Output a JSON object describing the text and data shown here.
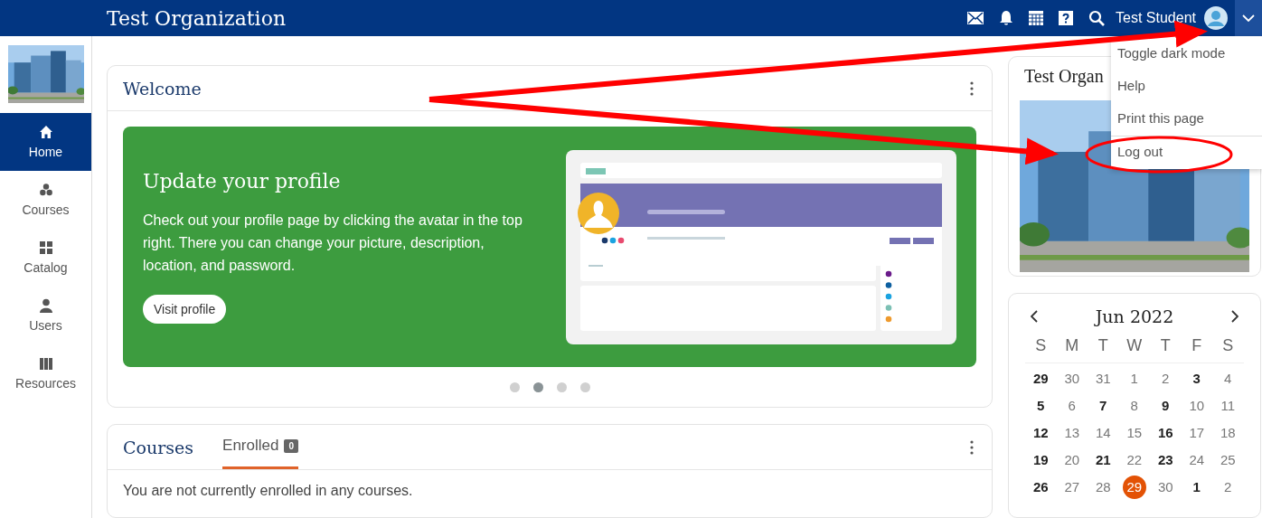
{
  "header": {
    "title": "Test Organization",
    "user_name": "Test Student"
  },
  "user_menu": {
    "items": [
      {
        "label": "Toggle dark mode",
        "separator_above": false
      },
      {
        "label": "Help",
        "separator_above": false
      },
      {
        "label": "Print this page",
        "separator_above": false
      },
      {
        "label": "Log out",
        "separator_above": true
      }
    ]
  },
  "sidebar": {
    "items": [
      {
        "kind": "home",
        "label": "Home",
        "selected": true
      },
      {
        "kind": "courses",
        "label": "Courses",
        "selected": false
      },
      {
        "kind": "catalog",
        "label": "Catalog",
        "selected": false
      },
      {
        "kind": "users",
        "label": "Users",
        "selected": false
      },
      {
        "kind": "resources",
        "label": "Resources",
        "selected": false
      }
    ]
  },
  "welcome_card": {
    "title": "Welcome",
    "slide": {
      "title": "Update your profile",
      "text": "Check out your profile page by clicking the avatar in the top right. There you can change your picture, description, location, and password.",
      "button": "Visit profile"
    },
    "slides": [
      {
        "selected": false
      },
      {
        "selected": true
      },
      {
        "selected": false
      },
      {
        "selected": false
      }
    ]
  },
  "courses_card": {
    "title": "Courses",
    "tabs": [
      {
        "label": "Enrolled",
        "count": "0",
        "selected": true
      }
    ],
    "empty_message": "You are not currently enrolled in any courses."
  },
  "organization_card": {
    "title": "Test Organ"
  },
  "calendar": {
    "month": "Jun 2022",
    "weekdays": [
      "S",
      "M",
      "T",
      "W",
      "T",
      "F",
      "S"
    ],
    "weeks": [
      [
        {
          "day": "29",
          "has_events": true,
          "selected": false
        },
        {
          "day": "30",
          "has_events": false,
          "selected": false
        },
        {
          "day": "31",
          "has_events": false,
          "selected": false
        },
        {
          "day": "1",
          "has_events": false,
          "selected": false
        },
        {
          "day": "2",
          "has_events": false,
          "selected": false
        },
        {
          "day": "3",
          "has_events": true,
          "selected": false
        },
        {
          "day": "4",
          "has_events": false,
          "selected": false
        }
      ],
      [
        {
          "day": "5",
          "has_events": true,
          "selected": false
        },
        {
          "day": "6",
          "has_events": false,
          "selected": false
        },
        {
          "day": "7",
          "has_events": true,
          "selected": false
        },
        {
          "day": "8",
          "has_events": false,
          "selected": false
        },
        {
          "day": "9",
          "has_events": true,
          "selected": false
        },
        {
          "day": "10",
          "has_events": false,
          "selected": false
        },
        {
          "day": "11",
          "has_events": false,
          "selected": false
        }
      ],
      [
        {
          "day": "12",
          "has_events": true,
          "selected": false
        },
        {
          "day": "13",
          "has_events": false,
          "selected": false
        },
        {
          "day": "14",
          "has_events": false,
          "selected": false
        },
        {
          "day": "15",
          "has_events": false,
          "selected": false
        },
        {
          "day": "16",
          "has_events": true,
          "selected": false
        },
        {
          "day": "17",
          "has_events": false,
          "selected": false
        },
        {
          "day": "18",
          "has_events": false,
          "selected": false
        }
      ],
      [
        {
          "day": "19",
          "has_events": true,
          "selected": false
        },
        {
          "day": "20",
          "has_events": false,
          "selected": false
        },
        {
          "day": "21",
          "has_events": true,
          "selected": false
        },
        {
          "day": "22",
          "has_events": false,
          "selected": false
        },
        {
          "day": "23",
          "has_events": true,
          "selected": false
        },
        {
          "day": "24",
          "has_events": false,
          "selected": false
        },
        {
          "day": "25",
          "has_events": false,
          "selected": false
        }
      ],
      [
        {
          "day": "26",
          "has_events": true,
          "selected": false
        },
        {
          "day": "27",
          "has_events": false,
          "selected": false
        },
        {
          "day": "28",
          "has_events": false,
          "selected": false
        },
        {
          "day": "29",
          "has_events": false,
          "selected": true
        },
        {
          "day": "30",
          "has_events": false,
          "selected": false
        },
        {
          "day": "1",
          "has_events": true,
          "selected": false
        },
        {
          "day": "2",
          "has_events": false,
          "selected": false
        }
      ]
    ]
  }
}
